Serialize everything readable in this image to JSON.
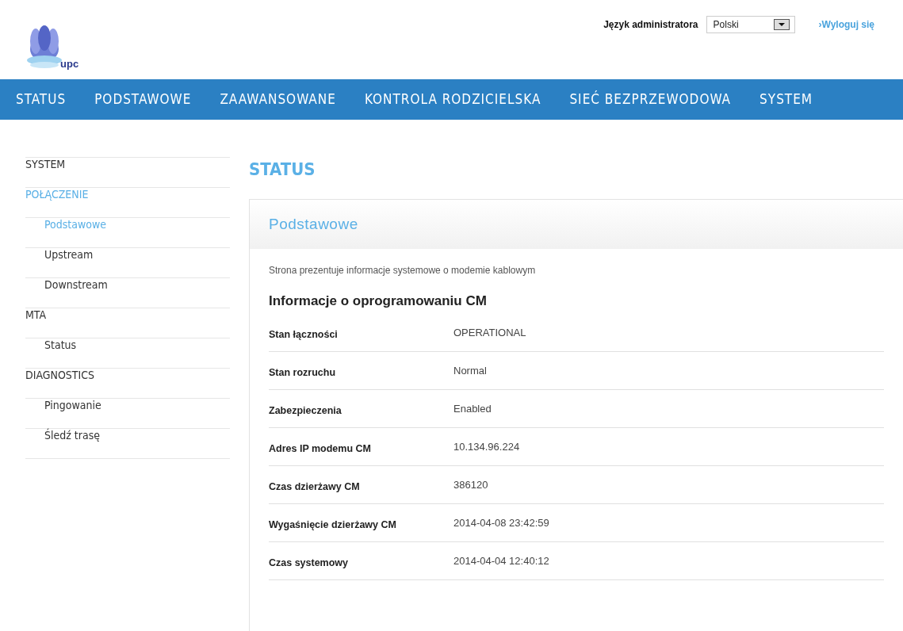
{
  "header": {
    "logo_text": "upc",
    "language_label": "Język administratora",
    "language_value": "Polski",
    "logout": "›Wyloguj się"
  },
  "nav": [
    {
      "label": "STATUS",
      "selected": false
    },
    {
      "label": "PODSTAWOWE",
      "selected": false
    },
    {
      "label": "ZAAWANSOWANE",
      "selected": false
    },
    {
      "label": "KONTROLA RODZICIELSKA",
      "selected": false
    },
    {
      "label": "SIEĆ BEZPRZEWODOWA",
      "selected": false
    },
    {
      "label": "SYSTEM",
      "selected": false
    }
  ],
  "sidebar": {
    "items": [
      {
        "label": "SYSTEM",
        "selected": false
      },
      {
        "label": "POŁĄCZENIE",
        "selected": true,
        "children": [
          {
            "label": "Podstawowe",
            "selected": true
          },
          {
            "label": "Upstream",
            "selected": false
          },
          {
            "label": "Downstream",
            "selected": false
          }
        ]
      },
      {
        "label": "MTA",
        "selected": false,
        "children": [
          {
            "label": "Status",
            "selected": false
          }
        ]
      },
      {
        "label": "DIAGNOSTICS",
        "selected": false,
        "children": [
          {
            "label": "Pingowanie",
            "selected": false
          },
          {
            "label": "Śledź trasę",
            "selected": false
          }
        ]
      }
    ]
  },
  "page_title": "STATUS",
  "card": {
    "title": "Podstawowe",
    "description": "Strona prezentuje informacje systemowe o modemie kablowym",
    "section_title": "Informacje o oprogramowaniu CM",
    "rows": [
      {
        "label": "Stan łączności",
        "value": "OPERATIONAL"
      },
      {
        "label": "Stan rozruchu",
        "value": "Normal"
      },
      {
        "label": "Zabezpieczenia",
        "value": "Enabled"
      },
      {
        "label": "Adres IP modemu CM",
        "value": "10.134.96.224"
      },
      {
        "label": "Czas dzierżawy CM",
        "value": "386120"
      },
      {
        "label": "Wygaśnięcie dzierżawy CM",
        "value": "2014-04-08 23:42:59"
      },
      {
        "label": "Czas systemowy",
        "value": "2014-04-04 12:40:12"
      }
    ]
  }
}
